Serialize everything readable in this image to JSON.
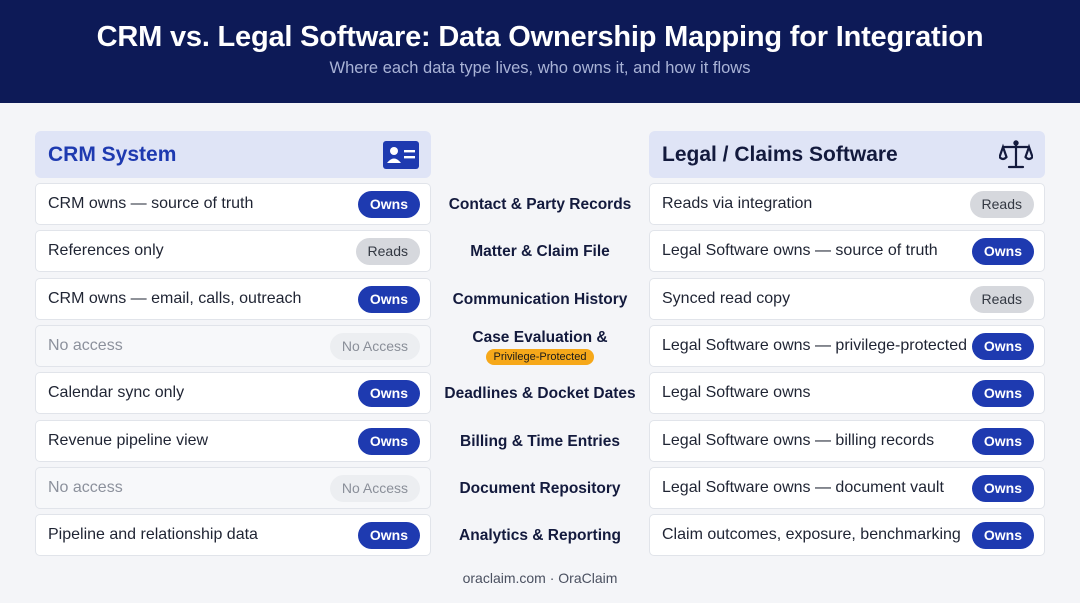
{
  "header": {
    "title": "CRM vs. Legal Software: Data Ownership Mapping for Integration",
    "subtitle": "Where each data type lives, who owns it, and how it flows"
  },
  "columns": {
    "left_title": "CRM System",
    "left_icon": "contact-card-icon",
    "right_title": "Legal / Claims Software",
    "right_icon": "scales-icon"
  },
  "rows": [
    {
      "category": "Contact & Party Records",
      "crm_text": "CRM owns — source of truth",
      "crm_badge": "Owns",
      "legal_text": "Reads via integration",
      "legal_badge": "Reads"
    },
    {
      "category": "Matter & Claim File",
      "crm_text": "References only",
      "crm_badge": "Reads",
      "legal_text": "Legal Software owns — source of truth",
      "legal_badge": "Owns"
    },
    {
      "category": "Communication History",
      "crm_text": "CRM owns — email, calls, outreach",
      "crm_badge": "Owns",
      "legal_text": "Synced read copy",
      "legal_badge": "Reads"
    },
    {
      "category": "Case Evaluation &",
      "tag": "Privilege-Protected",
      "crm_text": "No access",
      "crm_badge": "No Access",
      "legal_text": "Legal Software owns — privilege-protected",
      "legal_badge": "Owns"
    },
    {
      "category": "Deadlines & Docket Dates",
      "crm_text": "Calendar sync only",
      "crm_badge": "Owns",
      "legal_text": "Legal Software owns",
      "legal_badge": "Owns"
    },
    {
      "category": "Billing & Time Entries",
      "crm_text": "Revenue pipeline view",
      "crm_badge": "Owns",
      "legal_text": "Legal Software owns — billing records",
      "legal_badge": "Owns"
    },
    {
      "category": "Document Repository",
      "crm_text": "No access",
      "crm_badge": "No Access",
      "legal_text": "Legal Software owns — document vault",
      "legal_badge": "Owns"
    },
    {
      "category": "Analytics & Reporting",
      "crm_text": "Pipeline and relationship data",
      "crm_badge": "Owns",
      "legal_text": "Claim outcomes, exposure, benchmarking",
      "legal_badge": "Owns"
    }
  ],
  "colors": {
    "header_bg": "#0d1a57",
    "accent": "#1e3ab0",
    "tag": "#f6a81a"
  },
  "footer": "oraclaim.com · OraClaim"
}
